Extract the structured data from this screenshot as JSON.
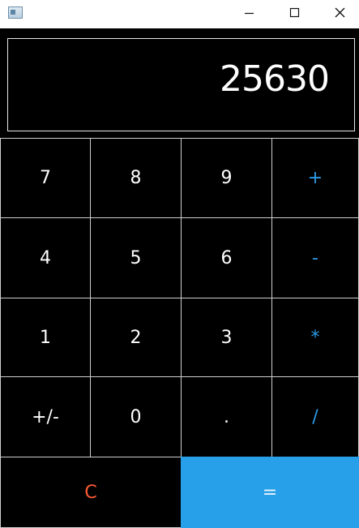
{
  "window": {
    "caption_icons": {
      "app": "app-window-icon",
      "minimize": "minimize-icon",
      "maximize": "maximize-icon",
      "close": "close-icon"
    }
  },
  "display": {
    "value": "25630"
  },
  "keypad": {
    "row1": [
      "7",
      "8",
      "9",
      "+"
    ],
    "row2": [
      "4",
      "5",
      "6",
      "-"
    ],
    "row3": [
      "1",
      "2",
      "3",
      "*"
    ],
    "row4": [
      "+/-",
      "0",
      ".",
      "/"
    ],
    "row5": [
      "C",
      "="
    ]
  },
  "colors": {
    "background": "#000000",
    "key_border": "#cfcfcf",
    "operator": "#2b9be8",
    "clear": "#ff5a36",
    "equals_bg": "#27a0e9"
  }
}
